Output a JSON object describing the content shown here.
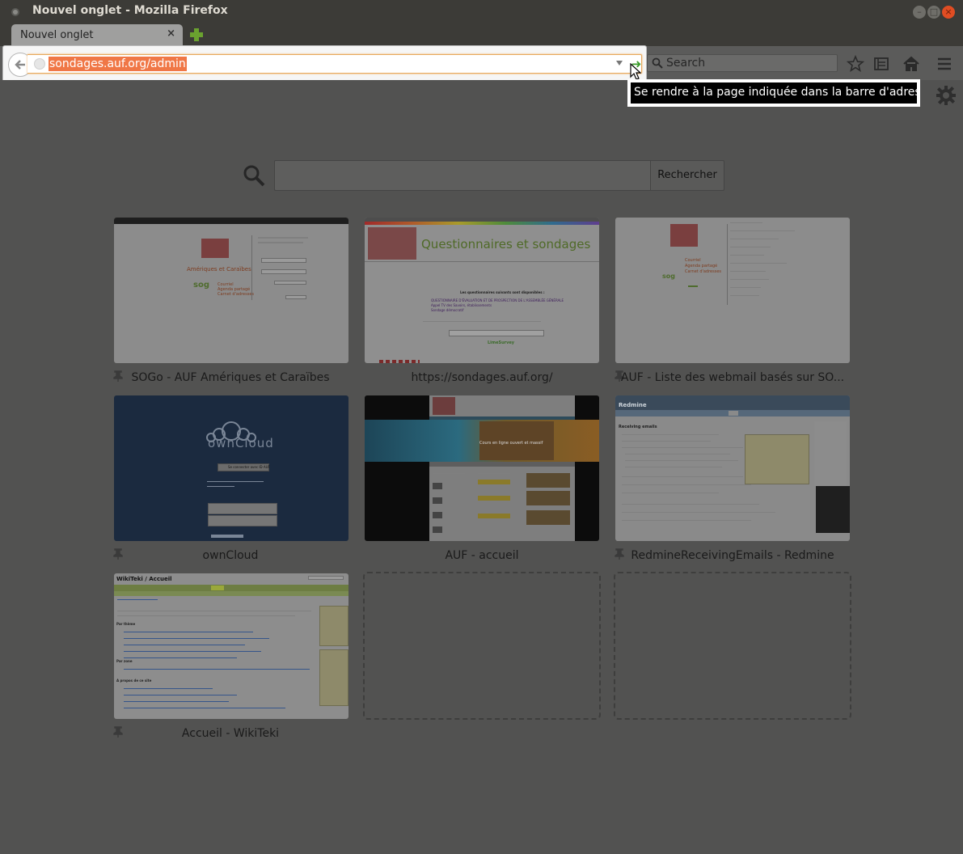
{
  "window": {
    "title": "Nouvel onglet - Mozilla Firefox"
  },
  "tabs": [
    {
      "label": "Nouvel onglet",
      "close": "×"
    }
  ],
  "navbar": {
    "url": "sondages.auf.org/admin",
    "search_placeholder": "Search",
    "tooltip": "Se rendre à la page indiquée dans la barre d'adresse"
  },
  "newtab": {
    "search_button": "Rechercher"
  },
  "tiles": [
    {
      "title": "SOGo - AUF Amériques et Caraïbes",
      "pinned": true,
      "thumb_heading": "Amériques et Caraïbes",
      "thumb_links": [
        "Courriel",
        "Agenda partagé",
        "Carnet d'adresses"
      ]
    },
    {
      "title": "https://sondages.auf.org/",
      "pinned": false,
      "thumb_heading": "Questionnaires et sondages",
      "thumb_text": "Les questionnaires suivants sont disponibles :",
      "thumb_items": [
        "QUESTIONNAIRE D'ÉVALUATION ET DE PROSPECTION DE L'ASSEMBLÉE GÉNÉRALE",
        "Appel TV des Savoirs, établissements",
        "Sondage démocratif"
      ],
      "thumb_footer": "LimeSurvey"
    },
    {
      "title": "AUF - Liste des webmail basés sur SO...",
      "pinned": true,
      "thumb_links": [
        "Courriel",
        "Agenda partagé",
        "Carnet d'adresses"
      ]
    },
    {
      "title": "ownCloud",
      "pinned": true,
      "thumb_heading": "ownCloud",
      "thumb_button": "Se connecter avec ID AUF"
    },
    {
      "title": "AUF - accueil",
      "pinned": false,
      "thumb_banner": "Cours en ligne ouvert et massif"
    },
    {
      "title": "RedmineReceivingEmails - Redmine",
      "pinned": true,
      "thumb_heading": "Redmine",
      "thumb_subheading": "Receiving emails"
    },
    {
      "title": "Accueil - WikiTeki",
      "pinned": true,
      "thumb_heading": "WikiTeki / Accueil",
      "thumb_sections": [
        "Par thème",
        "Par zone",
        "A propos de ce site"
      ]
    }
  ],
  "colors": {
    "overlay_bg": "#525251",
    "url_highlight": "#f07746",
    "go_arrow": "#3a9b2a",
    "auf_red": "#c0272d",
    "sogo_green": "#7cb740"
  }
}
